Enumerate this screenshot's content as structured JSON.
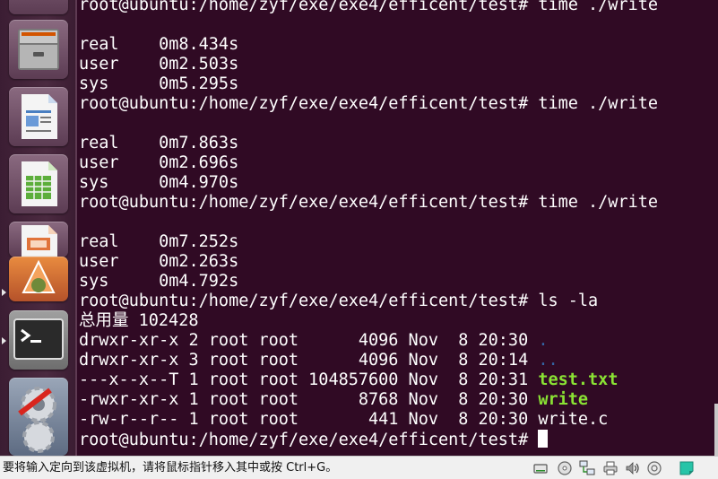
{
  "launcher": {
    "apps": [
      {
        "name": "files-icon"
      },
      {
        "name": "writer-icon"
      },
      {
        "name": "calc-icon"
      },
      {
        "name": "impress-icon"
      },
      {
        "name": "software-center-icon"
      },
      {
        "name": "terminal-icon"
      },
      {
        "name": "system-settings-icon"
      }
    ]
  },
  "terminal": {
    "lines": [
      {
        "text": "root@ubuntu:/home/zyf/exe/exe4/efficent/test# time ./write"
      },
      {
        "text": ""
      },
      {
        "text": "real\t0m8.434s"
      },
      {
        "text": "user\t0m2.503s"
      },
      {
        "text": "sys\t0m5.295s"
      },
      {
        "text": "root@ubuntu:/home/zyf/exe/exe4/efficent/test# time ./write"
      },
      {
        "text": ""
      },
      {
        "text": "real\t0m7.863s"
      },
      {
        "text": "user\t0m2.696s"
      },
      {
        "text": "sys\t0m4.970s"
      },
      {
        "text": "root@ubuntu:/home/zyf/exe/exe4/efficent/test# time ./write"
      },
      {
        "text": ""
      },
      {
        "text": "real\t0m7.252s"
      },
      {
        "text": "user\t0m2.263s"
      },
      {
        "text": "sys\t0m4.792s"
      },
      {
        "text": "root@ubuntu:/home/zyf/exe/exe4/efficent/test# ls -la"
      },
      {
        "text": "总用量 102428"
      }
    ],
    "listing": [
      {
        "prefix": "drwxr-xr-x 2 root root      4096 Nov  8 20:30 ",
        "name": ".",
        "kind": "dir"
      },
      {
        "prefix": "drwxr-xr-x 3 root root      4096 Nov  8 20:14 ",
        "name": "..",
        "kind": "dir"
      },
      {
        "prefix": "---x--x--T 1 root root 104857600 Nov  8 20:31 ",
        "name": "test.txt",
        "kind": "exec"
      },
      {
        "prefix": "-rwxr-xr-x 1 root root      8768 Nov  8 20:30 ",
        "name": "write",
        "kind": "exec"
      },
      {
        "prefix": "-rw-r--r-- 1 root root       441 Nov  8 20:30 ",
        "name": "write.c",
        "kind": "file"
      }
    ],
    "prompt": "root@ubuntu:/home/zyf/exe/exe4/efficent/test# "
  },
  "statusbar": {
    "message": "要将输入定向到该虚拟机，请将鼠标指针移入其中或按 Ctrl+G。",
    "icons": [
      "hard-disk-icon",
      "cd-drive-icon",
      "network-icon",
      "printer-icon",
      "sound-icon",
      "usb-icon",
      "notes-icon"
    ]
  },
  "colors": {
    "terminal_bg": "#300a24",
    "dir": "#3465a4",
    "exec": "#8ae234"
  }
}
